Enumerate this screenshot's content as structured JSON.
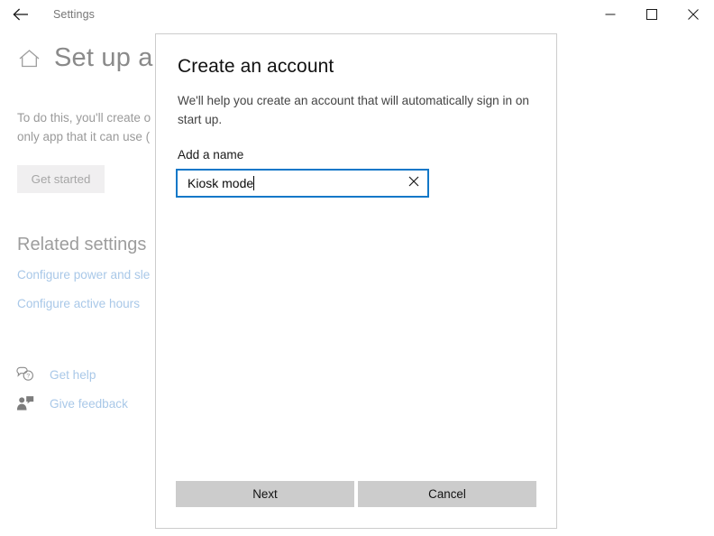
{
  "window": {
    "title": "Settings",
    "back_icon": "back-arrow-icon",
    "controls": {
      "minimize": "minimize-icon",
      "maximize": "maximize-icon",
      "close": "close-icon"
    }
  },
  "page": {
    "home_icon": "home-icon",
    "title": "Set up a k",
    "body_line1": "To do this, you'll create o",
    "body_line2": "only app that it can use (",
    "get_started_label": "Get started",
    "related_settings_heading": "Related settings",
    "related_links": [
      "Configure power and sle",
      "Configure active hours"
    ],
    "support": [
      {
        "icon": "help-bubble-icon",
        "label": "Get help"
      },
      {
        "icon": "feedback-person-icon",
        "label": "Give feedback"
      }
    ]
  },
  "dialog": {
    "title": "Create an account",
    "description": "We'll help you create an account that will automatically sign in on start up.",
    "field_label": "Add a name",
    "input_value": "Kiosk mode",
    "input_placeholder": "",
    "clear_icon": "clear-x-icon",
    "primary_button": "Next",
    "secondary_button": "Cancel"
  },
  "colors": {
    "accent_blue": "#1278c8",
    "link_blue": "#a9c8e8",
    "button_gray": "#cccccc",
    "dialog_border": "#cccccc"
  }
}
